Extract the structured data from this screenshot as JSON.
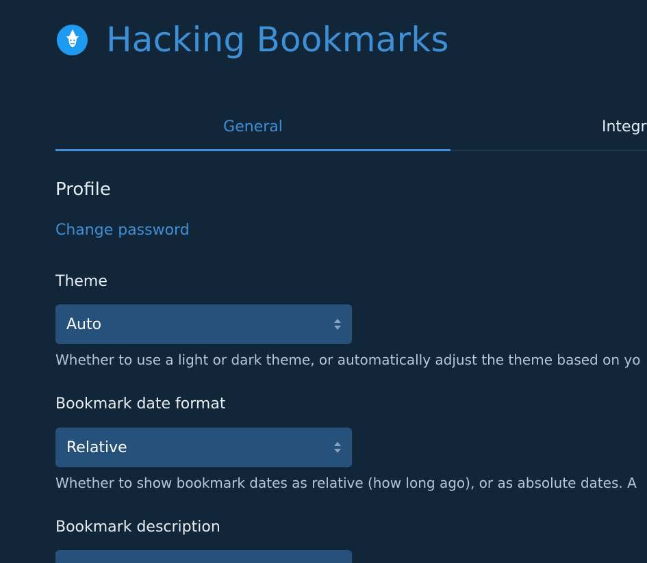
{
  "header": {
    "logo_icon": "wizard-logo-icon",
    "title": "Hacking Bookmarks"
  },
  "tabs": [
    {
      "label": "General",
      "active": true
    },
    {
      "label": "Integr",
      "active": false
    }
  ],
  "profile": {
    "heading": "Profile",
    "change_password": "Change password"
  },
  "theme": {
    "label": "Theme",
    "value": "Auto",
    "help": "Whether to use a light or dark theme, or automatically adjust the theme based on yo"
  },
  "date_format": {
    "label": "Bookmark date format",
    "value": "Relative",
    "help": "Whether to show bookmark dates as relative (how long ago), or as absolute dates. A"
  },
  "description": {
    "label": "Bookmark description"
  },
  "colors": {
    "background": "#12263a",
    "accent": "#3d8fd6",
    "select_bg": "#25517a",
    "logo_bg": "#1e9bf0"
  }
}
